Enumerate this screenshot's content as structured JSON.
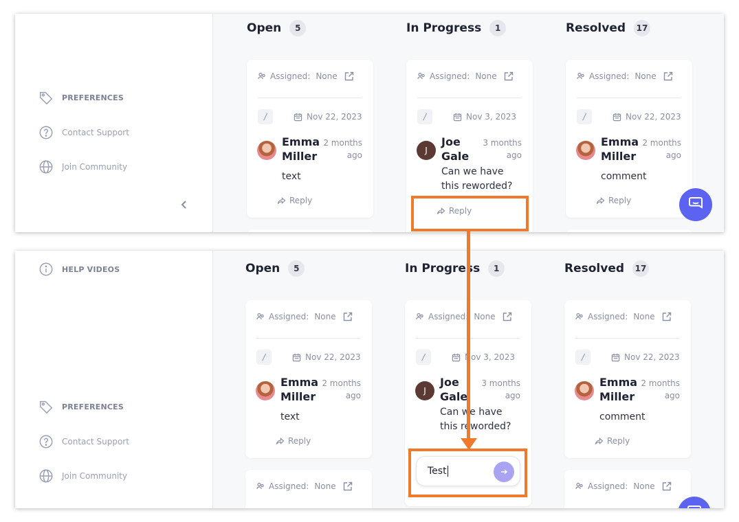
{
  "sidebar": {
    "help_videos": "HELP VIDEOS",
    "preferences": "PREFERENCES",
    "contact_support": "Contact Support",
    "join_community": "Join Community"
  },
  "columns": [
    {
      "title": "Open",
      "count": "5"
    },
    {
      "title": "In Progress",
      "count": "1"
    },
    {
      "title": "Resolved",
      "count": "17"
    }
  ],
  "card_common": {
    "assigned_label": "Assigned:",
    "assigned_value": "None",
    "reply_label": "Reply"
  },
  "cards": [
    {
      "date": "Nov 22, 2023",
      "author_first": "Emma",
      "author_last": "Miller",
      "time_ago": "2 months ago",
      "text": "text"
    },
    {
      "date": "Nov 3, 2023",
      "author_first": "Joe",
      "author_last": "Gale",
      "avatar_initial": "J",
      "time_ago": "3 months ago",
      "text": "Can we have this reworded?"
    },
    {
      "date": "Nov 22, 2023",
      "author_first": "Emma",
      "author_last": "Miller",
      "time_ago": "2 months ago",
      "text": "comment"
    }
  ],
  "reply_input": {
    "value": "Test"
  },
  "icons": {
    "collapse": "chevron-left-icon",
    "send": "arrow-right-icon",
    "chat": "chat-bubble-icon"
  },
  "colors": {
    "highlight": "#ef7a2b",
    "chat_button": "#5b63f0",
    "send_button": "#a9a3f2"
  }
}
